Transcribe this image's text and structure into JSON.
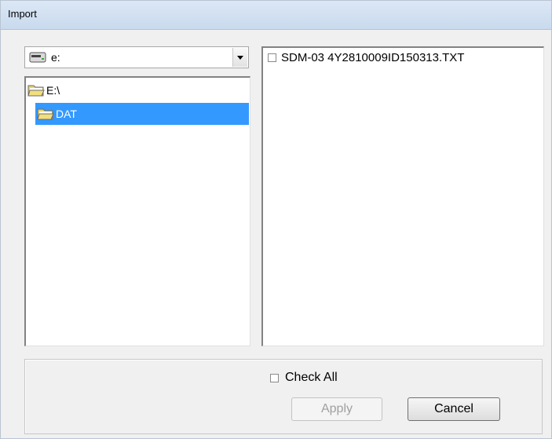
{
  "window": {
    "title": "Import"
  },
  "drive_combo": {
    "value": "e:",
    "icon": "drive-icon"
  },
  "folder_tree": {
    "items": [
      {
        "label": "E:\\",
        "icon": "open-folder-icon",
        "selected": false
      },
      {
        "label": "DAT",
        "icon": "open-folder-icon",
        "selected": true
      }
    ]
  },
  "file_list": {
    "items": [
      {
        "label": "SDM-03 4Y2810009ID150313.TXT",
        "checked": false
      }
    ]
  },
  "footer": {
    "check_all_label": "Check All",
    "check_all_checked": false,
    "apply_label": "Apply",
    "apply_enabled": false,
    "cancel_label": "Cancel"
  },
  "colors": {
    "selection": "#3399ff",
    "title_bar": "#c9daee",
    "dialog_bg": "#f0f0f0"
  }
}
